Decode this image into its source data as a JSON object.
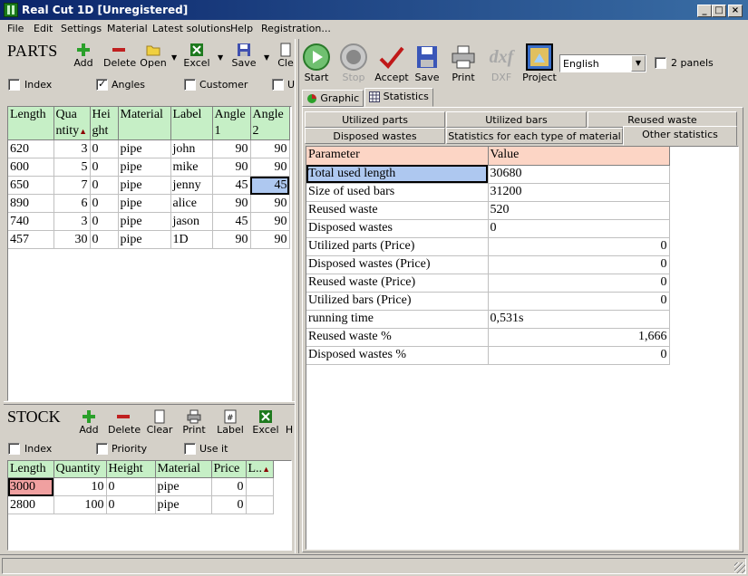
{
  "window": {
    "title": "Real Cut 1D [Unregistered]"
  },
  "menu": [
    "File",
    "Edit",
    "Settings",
    "Material",
    "Latest solutions",
    "Help",
    "Registration..."
  ],
  "parts": {
    "heading": "PARTS",
    "toolbar": {
      "add": "Add",
      "delete": "Delete",
      "open": "Open",
      "excel": "Excel",
      "save": "Save",
      "clear": "Cle"
    },
    "checks": {
      "index": "Index",
      "angles": "Angles",
      "customer": "Customer",
      "u": "U"
    },
    "columns": [
      "Length",
      "Qua ntity",
      "Hei ght",
      "Material",
      "Label",
      "Angle 1",
      "Angle 2"
    ],
    "rows": [
      [
        "620",
        "3",
        "0",
        "pipe",
        "john",
        "90",
        "90"
      ],
      [
        "600",
        "5",
        "0",
        "pipe",
        "mike",
        "90",
        "90"
      ],
      [
        "650",
        "7",
        "0",
        "pipe",
        "jenny",
        "45",
        "45"
      ],
      [
        "890",
        "6",
        "0",
        "pipe",
        "alice",
        "90",
        "90"
      ],
      [
        "740",
        "3",
        "0",
        "pipe",
        "jason",
        "45",
        "90"
      ],
      [
        "457",
        "30",
        "0",
        "pipe",
        "1D",
        "90",
        "90"
      ]
    ]
  },
  "stock": {
    "heading": "STOCK",
    "toolbar": {
      "add": "Add",
      "delete": "Delete",
      "clear": "Clear",
      "print": "Print",
      "label": "Label",
      "excel": "Excel",
      "h": "H"
    },
    "checks": {
      "index": "Index",
      "priority": "Priority",
      "useit": "Use it"
    },
    "columns": [
      "Length",
      "Quantity",
      "Height",
      "Material",
      "Price",
      "L.."
    ],
    "rows": [
      [
        "3000",
        "10",
        "0",
        "pipe",
        "0",
        ""
      ],
      [
        "2800",
        "100",
        "0",
        "pipe",
        "0",
        ""
      ]
    ]
  },
  "main_toolbar": {
    "start": "Start",
    "stop": "Stop",
    "accept": "Accept",
    "save": "Save",
    "print": "Print",
    "dxf": "DXF",
    "dxf_logo": "dxf",
    "project": "Project"
  },
  "language": "English",
  "two_panels": "2 panels",
  "view_tabs": {
    "graphic": "Graphic",
    "statistics": "Statistics"
  },
  "stat_tabs": {
    "row1": [
      "Utilized parts",
      "Utilized bars",
      "Reused waste"
    ],
    "row2": [
      "Disposed wastes",
      "Statistics for each type of material",
      "Other statistics"
    ]
  },
  "stats": {
    "col_param": "Parameter",
    "col_value": "Value",
    "rows": [
      {
        "param": "Total used length",
        "value": "30680",
        "align": "left"
      },
      {
        "param": "Size of used bars",
        "value": "31200",
        "align": "left"
      },
      {
        "param": "Reused waste",
        "value": "520",
        "align": "left"
      },
      {
        "param": "Disposed wastes",
        "value": "0",
        "align": "left"
      },
      {
        "param": "Utilized parts (Price)",
        "value": "0",
        "align": "right"
      },
      {
        "param": "Disposed wastes (Price)",
        "value": "0",
        "align": "right"
      },
      {
        "param": "Reused waste (Price)",
        "value": "0",
        "align": "right"
      },
      {
        "param": "Utilized bars (Price)",
        "value": "0",
        "align": "right"
      },
      {
        "param": "running time",
        "value": "0,531s",
        "align": "left"
      },
      {
        "param": "Reused waste %",
        "value": "1,666",
        "align": "right"
      },
      {
        "param": "Disposed wastes %",
        "value": "0",
        "align": "right"
      }
    ]
  }
}
